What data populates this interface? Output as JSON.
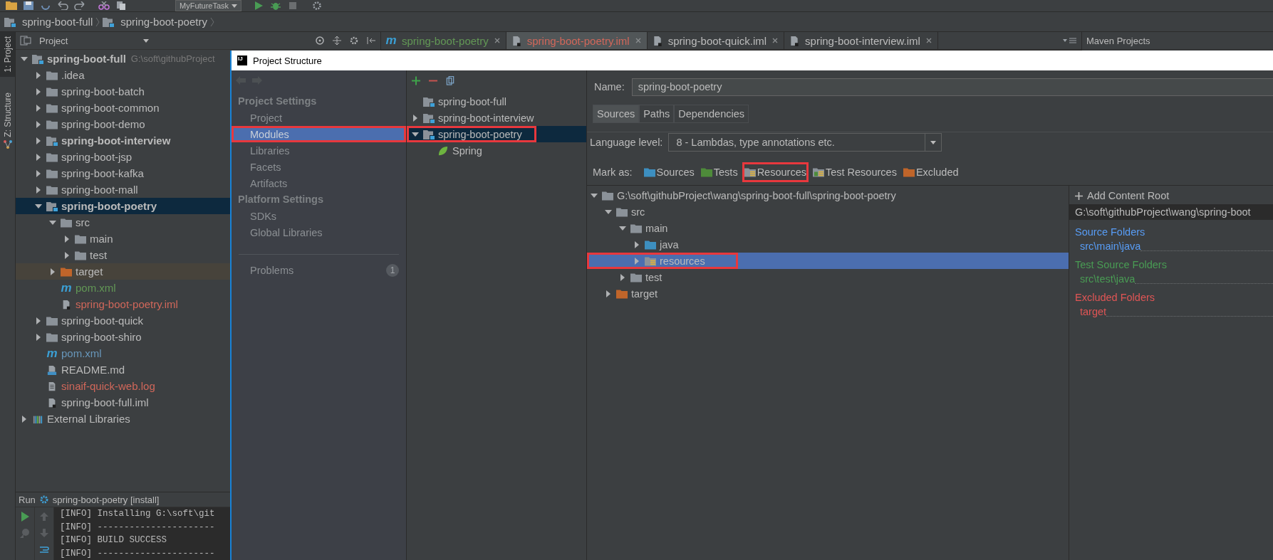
{
  "toolbar": {
    "run_config": "MyFutureTask"
  },
  "breadcrumbs": [
    "spring-boot-full",
    "spring-boot-poetry"
  ],
  "tool_strip": [
    {
      "label": "1: Project",
      "selected": true
    },
    {
      "label": "Z: Structure",
      "selected": false
    }
  ],
  "project_panel": {
    "title": "Project",
    "tree": [
      {
        "name": "spring-boot-full",
        "kind": "module",
        "color": "#bbbbbb",
        "hint": "G:\\soft\\githubProject",
        "expanded": true,
        "selected": false,
        "children": [
          {
            "name": ".idea",
            "kind": "folder",
            "color": "#bbbbbb",
            "expanded": false,
            "selected": false
          },
          {
            "name": "spring-boot-batch",
            "kind": "folder",
            "color": "#bbbbbb",
            "expanded": false,
            "selected": false
          },
          {
            "name": "spring-boot-common",
            "kind": "folder",
            "color": "#bbbbbb",
            "expanded": false,
            "selected": false
          },
          {
            "name": "spring-boot-demo",
            "kind": "folder",
            "color": "#bbbbbb",
            "expanded": false,
            "selected": false
          },
          {
            "name": "spring-boot-interview",
            "kind": "module",
            "color": "#bbbbbb",
            "expanded": false,
            "selected": false
          },
          {
            "name": "spring-boot-jsp",
            "kind": "folder",
            "color": "#bbbbbb",
            "expanded": false,
            "selected": false
          },
          {
            "name": "spring-boot-kafka",
            "kind": "folder",
            "color": "#bbbbbb",
            "expanded": false,
            "selected": false
          },
          {
            "name": "spring-boot-mall",
            "kind": "folder",
            "color": "#bbbbbb",
            "expanded": false,
            "selected": false
          },
          {
            "name": "spring-boot-poetry",
            "kind": "module",
            "color": "#bbbbbb",
            "expanded": true,
            "selected": true,
            "children": [
              {
                "name": "src",
                "kind": "folder",
                "color": "#bbbbbb",
                "expanded": true,
                "selected": false,
                "children": [
                  {
                    "name": "main",
                    "kind": "folder",
                    "color": "#bbbbbb",
                    "expanded": false,
                    "selected": false
                  },
                  {
                    "name": "test",
                    "kind": "folder",
                    "color": "#bbbbbb",
                    "expanded": false,
                    "selected": false
                  }
                ]
              },
              {
                "name": "target",
                "kind": "excluded",
                "color": "#bbbbbb",
                "expanded": false,
                "selected": false
              },
              {
                "name": "pom.xml",
                "kind": "maven",
                "icon_text": "m",
                "color": "#629755",
                "selected": false
              },
              {
                "name": "spring-boot-poetry.iml",
                "kind": "iml",
                "color": "#d1675a",
                "selected": false
              }
            ]
          },
          {
            "name": "spring-boot-quick",
            "kind": "folder",
            "color": "#bbbbbb",
            "expanded": false,
            "selected": false
          },
          {
            "name": "spring-boot-shiro",
            "kind": "folder",
            "color": "#bbbbbb",
            "expanded": false,
            "selected": false
          },
          {
            "name": "pom.xml",
            "kind": "maven",
            "icon_text": "m",
            "color": "#6897bb",
            "selected": false
          },
          {
            "name": "README.md",
            "kind": "markdown",
            "color": "#bbbbbb",
            "selected": false
          },
          {
            "name": "sinaif-quick-web.log",
            "kind": "log",
            "color": "#d1675a",
            "selected": false
          },
          {
            "name": "spring-boot-full.iml",
            "kind": "iml",
            "color": "#bbbbbb",
            "selected": false
          }
        ]
      },
      {
        "name": "External Libraries",
        "kind": "libraries",
        "color": "#bbbbbb",
        "expanded": false,
        "selected": false
      }
    ]
  },
  "run_panel": {
    "label": "Run",
    "config": "spring-boot-poetry [install]",
    "lines": [
      "[INFO] Installing G:\\soft\\git",
      "[INFO] ----------------------",
      "[INFO] BUILD SUCCESS",
      "[INFO] ----------------------"
    ]
  },
  "editor_tabs": [
    {
      "label": "spring-boot-poetry",
      "kind": "maven",
      "icon_text": "m",
      "color": "#629755",
      "selected": false
    },
    {
      "label": "spring-boot-poetry.iml",
      "kind": "iml",
      "color": "#d1675a",
      "selected": true
    },
    {
      "label": "spring-boot-quick.iml",
      "kind": "iml",
      "color": "#bbbbbb",
      "selected": false
    },
    {
      "label": "spring-boot-interview.iml",
      "kind": "iml",
      "color": "#bbbbbb",
      "selected": false
    }
  ],
  "maven_panel": {
    "title": "Maven Projects"
  },
  "dialog": {
    "logo": "IJ",
    "title": "Project Structure",
    "nav": [
      {
        "label": "Project Settings",
        "kind": "header"
      },
      {
        "label": "Project",
        "kind": "item",
        "selected": false,
        "highlighted": false
      },
      {
        "label": "Modules",
        "kind": "item",
        "selected": true,
        "highlighted": true
      },
      {
        "label": "Libraries",
        "kind": "item",
        "selected": false,
        "highlighted": false
      },
      {
        "label": "Facets",
        "kind": "item",
        "selected": false,
        "highlighted": false
      },
      {
        "label": "Artifacts",
        "kind": "item",
        "selected": false,
        "highlighted": false
      },
      {
        "label": "Platform Settings",
        "kind": "header"
      },
      {
        "label": "SDKs",
        "kind": "item",
        "selected": false,
        "highlighted": false
      },
      {
        "label": "Global Libraries",
        "kind": "item",
        "selected": false,
        "highlighted": false
      },
      {
        "label": "Problems",
        "kind": "problems",
        "badge": "1",
        "selected": false,
        "highlighted": false
      }
    ],
    "modules": [
      {
        "name": "spring-boot-full",
        "kind": "module",
        "selected": false,
        "highlighted": false
      },
      {
        "name": "spring-boot-interview",
        "kind": "module",
        "expanded": false,
        "selected": false,
        "highlighted": false
      },
      {
        "name": "spring-boot-poetry",
        "kind": "module",
        "expanded": true,
        "selected": true,
        "highlighted": true,
        "children": [
          {
            "name": "Spring",
            "kind": "spring",
            "selected": false,
            "highlighted": false
          }
        ]
      }
    ],
    "editor": {
      "name_label": "Name:",
      "name_value": "spring-boot-poetry",
      "tabs": [
        {
          "label": "Sources",
          "selected": true
        },
        {
          "label": "Paths",
          "selected": false
        },
        {
          "label": "Dependencies",
          "selected": false
        }
      ],
      "language_label": "Language level:",
      "language_value": "8 - Lambdas, type annotations etc.",
      "mark_as_label": "Mark as:",
      "mark_as": [
        {
          "label": "Sources",
          "kind": "source",
          "highlighted": false
        },
        {
          "label": "Tests",
          "kind": "test",
          "highlighted": false
        },
        {
          "label": "Resources",
          "kind": "resource",
          "highlighted": true
        },
        {
          "label": "Test Resources",
          "kind": "test-resource",
          "highlighted": false
        },
        {
          "label": "Excluded",
          "kind": "excluded",
          "highlighted": false
        }
      ],
      "content_tree": [
        {
          "name": "G:\\soft\\githubProject\\wang\\spring-boot-full\\spring-boot-poetry",
          "kind": "folder",
          "expanded": true,
          "selected": false,
          "highlighted": false,
          "children": [
            {
              "name": "src",
              "kind": "folder",
              "expanded": true,
              "selected": false,
              "highlighted": false,
              "children": [
                {
                  "name": "main",
                  "kind": "folder",
                  "expanded": true,
                  "selected": false,
                  "highlighted": false,
                  "children": [
                    {
                      "name": "java",
                      "kind": "source",
                      "expanded": false,
                      "selected": false,
                      "highlighted": false
                    },
                    {
                      "name": "resources",
                      "kind": "resource",
                      "expanded": false,
                      "selected": true,
                      "highlighted": true
                    }
                  ]
                },
                {
                  "name": "test",
                  "kind": "folder",
                  "expanded": false,
                  "selected": false,
                  "highlighted": false
                }
              ]
            },
            {
              "name": "target",
              "kind": "excluded",
              "expanded": false,
              "selected": false,
              "highlighted": false
            }
          ]
        }
      ],
      "content_root": {
        "add_label": "Add Content Root",
        "path": "G:\\soft\\githubProject\\wang\\spring-boot",
        "groups": [
          {
            "title": "Source Folders",
            "kind": "source",
            "folders": [
              "src\\main\\java"
            ]
          },
          {
            "title": "Test Source Folders",
            "kind": "test",
            "folders": [
              "src\\test\\java"
            ]
          },
          {
            "title": "Excluded Folders",
            "kind": "excluded",
            "folders": [
              "target"
            ]
          }
        ]
      }
    }
  }
}
